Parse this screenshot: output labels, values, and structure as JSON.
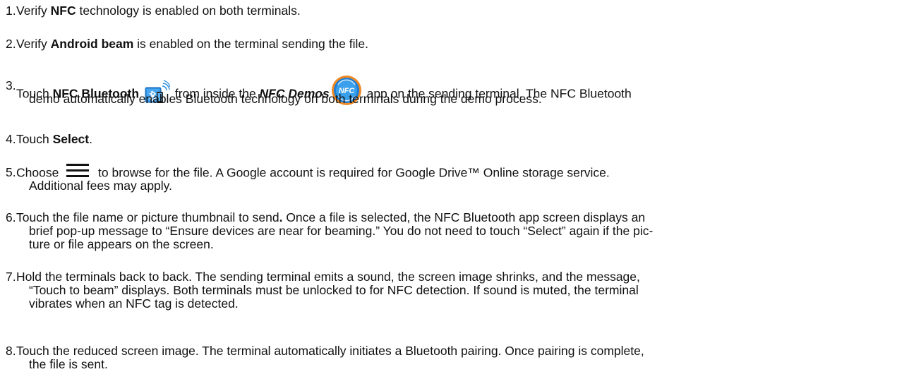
{
  "steps": [
    {
      "num": "1.",
      "parts": [
        "Verify ",
        "NFC",
        " technology is enabled on both terminals."
      ]
    },
    {
      "num": "2.",
      "parts": [
        "Verify ",
        "Android beam",
        " is enabled on the terminal sending the file."
      ]
    },
    {
      "num": "3.",
      "parts": [
        "Touch ",
        "NFC Bluetooth",
        " from inside the ",
        "NFC Demos",
        " app on the sending terminal. The NFC Bluetooth"
      ],
      "line2": "demo automatically enables Bluetooth technology on both terminals during the demo process."
    },
    {
      "num": "4.",
      "parts": [
        "Touch ",
        "Select",
        "."
      ]
    },
    {
      "num": "5.",
      "parts": [
        "Choose ",
        " to browse for the file. A Google account is required for Google Drive™ Online storage service."
      ],
      "line2": "Additional fees may apply."
    },
    {
      "num": "6.",
      "parts": [
        "Touch the file name or picture thumbnail to send",
        ".",
        " Once a file is selected, the NFC Bluetooth app screen displays an"
      ],
      "line2": "brief pop-up message to “Ensure devices are near for beaming.” You do not need to touch “Select” again if the pic-",
      "line3": "ture or file appears on the screen."
    },
    {
      "num": "7.",
      "line1": "Hold the terminals back to back. The sending terminal emits a sound, the screen image shrinks, and the message,",
      "line2": "“Touch to beam” displays. Both terminals must be unlocked to for NFC detection. If sound is muted, the terminal",
      "line3": "vibrates when an NFC tag is detected."
    },
    {
      "num": "8.",
      "line1": "Touch the reduced screen image. The terminal automatically initiates a Bluetooth pairing. Once pairing is complete,",
      "line2": "the file is sent."
    }
  ],
  "icons": {
    "bluetooth_app": "nfc-bluetooth-app-icon",
    "nfc_demos": "nfc-demos-app-icon",
    "menu": "hamburger-menu-icon",
    "nfc_icon_label": "NFC"
  },
  "colors": {
    "text": "#111111",
    "icon_blue": "#1e7fd6",
    "icon_orange": "#e8801a"
  }
}
